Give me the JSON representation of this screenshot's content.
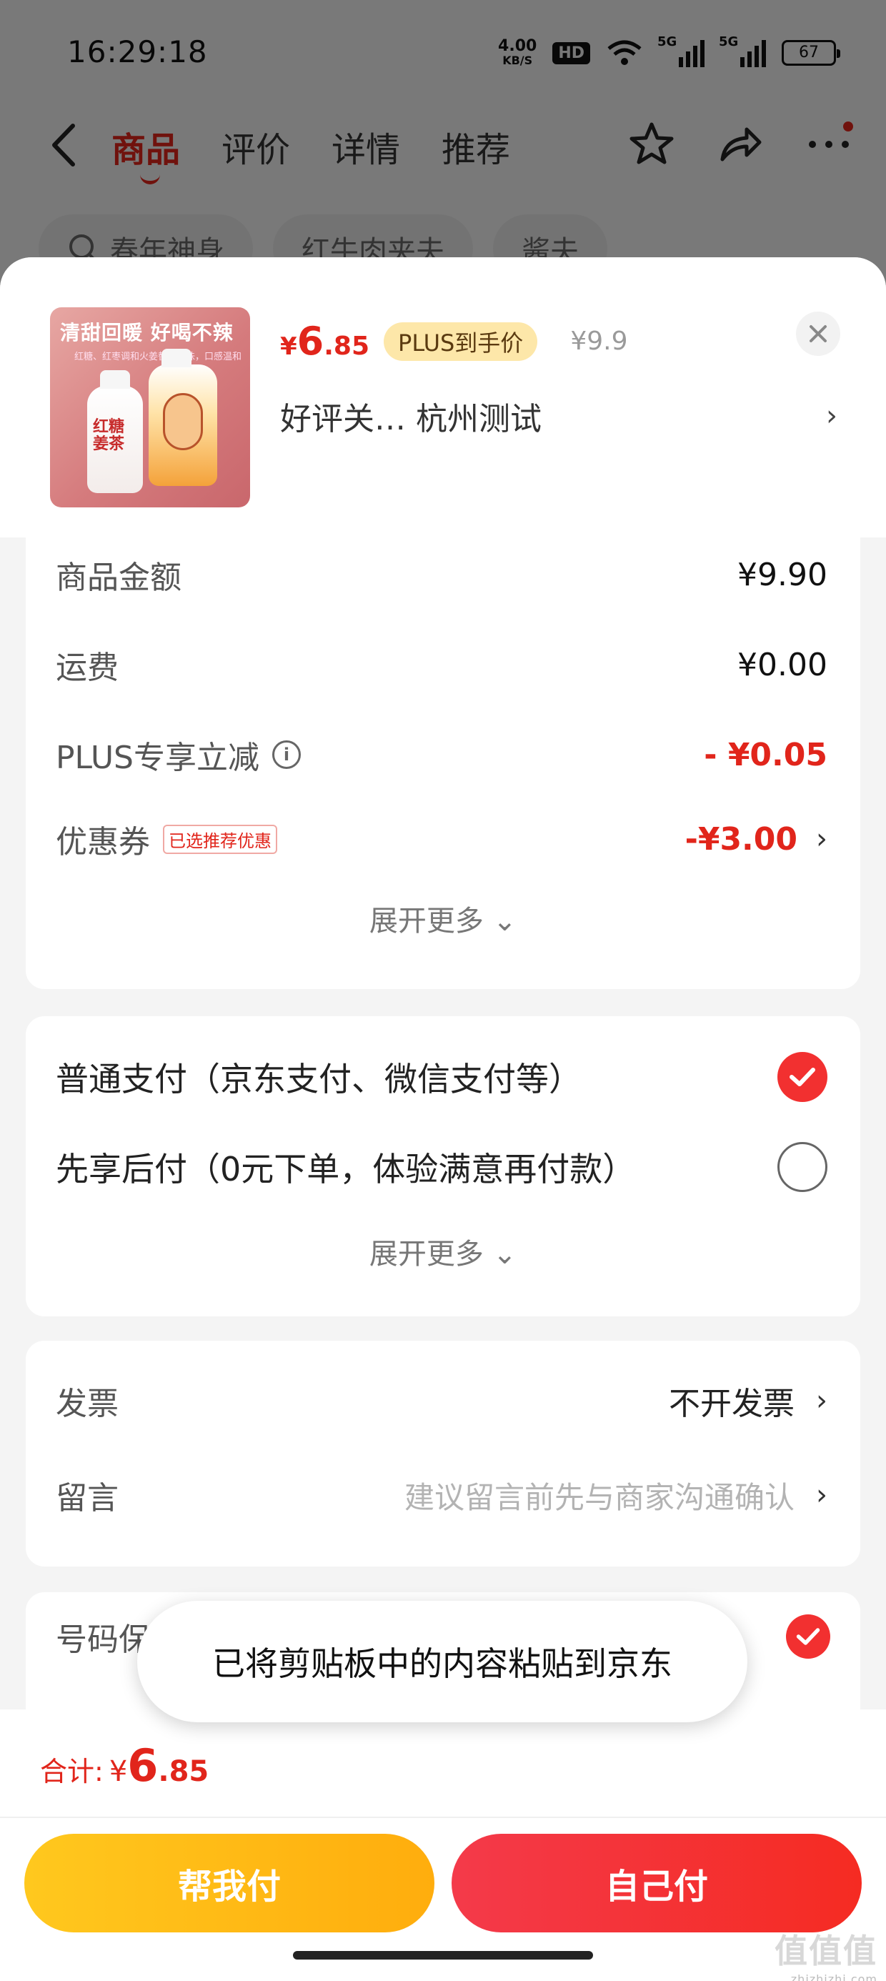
{
  "status_bar": {
    "time": "16:29:18",
    "net_speed": "4.00",
    "net_unit": "KB/S",
    "hd": "HD",
    "sim1": "5G",
    "sim2": "5G",
    "battery": "67"
  },
  "nav": {
    "tabs": [
      {
        "label": "商品",
        "active": true
      },
      {
        "label": "评价",
        "active": false
      },
      {
        "label": "详情",
        "active": false
      },
      {
        "label": "推荐",
        "active": false
      }
    ],
    "icons": [
      "star-icon",
      "share-icon",
      "more-icon"
    ]
  },
  "search_chips": [
    "春年神身",
    "红牛肉夹夫",
    "酱夫"
  ],
  "product": {
    "image_banner": "清甜回暖 好喝不辣",
    "image_sub": "红糖、红枣调和火姜替的本味，口感温和",
    "image_bottle_label": "红糖姜茶",
    "price_symbol": "¥",
    "price_int": "6",
    "price_dec": ".85",
    "plus_tag": "PLUS到手价",
    "original_price": "¥9.9",
    "spec": "好评关…  杭州测试",
    "chevron": "›"
  },
  "fees": {
    "goods_amount_label": "商品金额",
    "goods_amount_value": "¥9.90",
    "shipping_label": "运费",
    "shipping_value": "¥0.00",
    "plus_discount_label": "PLUS专享立减",
    "plus_discount_value": "- ¥0.05",
    "coupon_label": "优惠券",
    "coupon_tag": "已选推荐优惠",
    "coupon_value": "-¥3.00",
    "expand_label": "展开更多 ⌄"
  },
  "payment": {
    "option1": "普通支付（京东支付、微信支付等）",
    "option1_selected": true,
    "option2": "先享后付（0元下单，体验满意再付款）",
    "option2_selected": false,
    "expand_label": "展开更多 ⌄"
  },
  "extra": {
    "invoice_label": "发票",
    "invoice_value": "不开发票",
    "message_label": "留言",
    "message_placeholder": "建议留言前先与商家沟通确认"
  },
  "number_protect": {
    "label": "号码保"
  },
  "toast": {
    "text": "已将剪贴板中的内容粘贴到京东"
  },
  "total": {
    "label": "合计:",
    "symbol": "¥",
    "int": "6",
    "dec": ".85"
  },
  "actions": {
    "help_pay": "帮我付",
    "self_pay": "自己付"
  },
  "watermark": {
    "text": "值值值",
    "site": "zhizhizhi.com"
  },
  "colors": {
    "accent": "#e1251b",
    "plus_gold": "#fde7a9",
    "help_btn": "#ffbb15",
    "self_btn": "#f43a3a"
  }
}
